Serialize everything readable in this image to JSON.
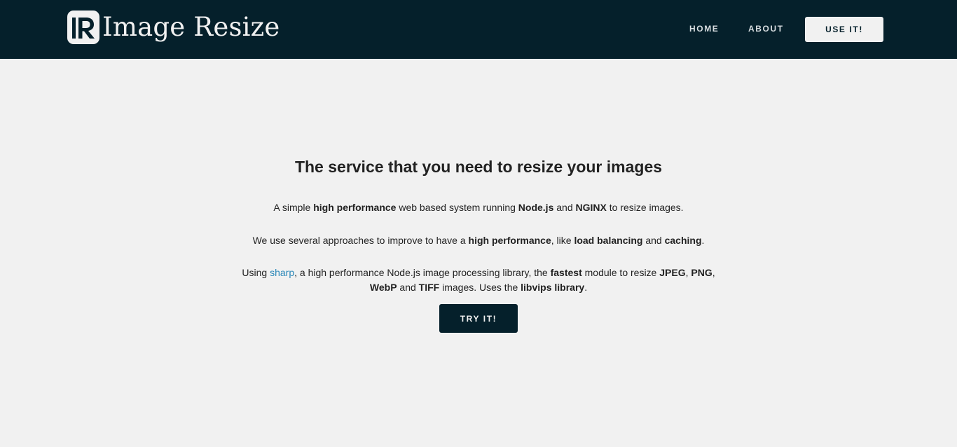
{
  "colors": {
    "navbar_bg": "#05202b",
    "page_bg": "#f1f1f1",
    "text": "#222222",
    "link": "#2a87b8"
  },
  "brand": {
    "logo_icon": "ir-logo-icon",
    "name": "Image Resize"
  },
  "nav": {
    "home": "HOME",
    "about": "ABOUT",
    "use": "USE IT!"
  },
  "main": {
    "headline": "The service that you need to resize your images",
    "p1": {
      "t1": "A simple ",
      "b1": "high performance",
      "t2": " web based system running ",
      "b2": "Node.js",
      "t3": " and ",
      "b3": "NGINX",
      "t4": " to resize images."
    },
    "p2": {
      "t1": "We use several approaches to improve to have a ",
      "b1": "high performance",
      "t2": ", like ",
      "b2": "load balancing",
      "t3": " and ",
      "b3": "caching",
      "t4": "."
    },
    "p3": {
      "t1": "Using ",
      "link": "sharp",
      "t2": ", a high performance Node.js image processing library, the ",
      "b1": "fastest",
      "t3": " module to resize ",
      "b2": "JPEG",
      "t4": ", ",
      "b3": "PNG",
      "t5": ", ",
      "b4": "WebP",
      "t6": " and ",
      "b5": "TIFF",
      "t7": " images. Uses the ",
      "b6": "libvips library",
      "t8": "."
    },
    "try_button": "TRY IT!"
  }
}
